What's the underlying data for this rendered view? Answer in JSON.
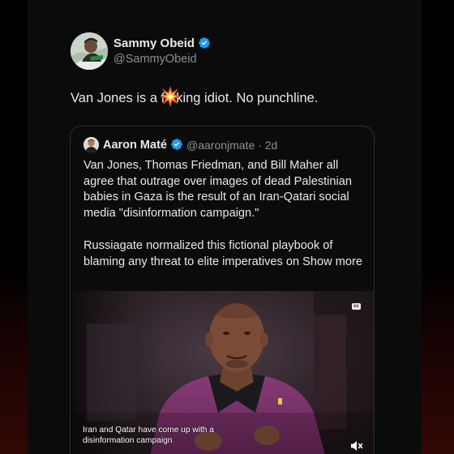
{
  "tweet": {
    "author": {
      "name": "Sammy Obeid",
      "handle": "@SammyObeid",
      "verified_icon": "verified-badge-icon"
    },
    "text_before": "Van Jones is a f",
    "text_emoji": "collision-emoji",
    "text_after": "king idiot. No punchline."
  },
  "quoted_tweet": {
    "author": {
      "name": "Aaron Maté",
      "handle": "@aaronjmate · 2d",
      "verified_icon": "verified-badge-icon"
    },
    "paragraphs": [
      "Van Jones, Thomas Friedman, and Bill Maher all agree that outrage over images of dead Palestinian babies in Gaza is the result of an Iran-Qatari social media \"disinformation campaign.\"",
      "Russiagate normalized this fictional playbook of blaming any threat to elite imperatives on"
    ],
    "show_more_label": "Show more",
    "video": {
      "cc_label": "cc",
      "caption_lines": [
        "Iran and Qatar have come up with a",
        "disinformation campaign"
      ],
      "mute_icon": "volume-muted-icon"
    }
  },
  "colors": {
    "background": "#000000",
    "panel": "#0b0b0c",
    "text_primary": "#e7e9ea",
    "text_secondary": "#8b8f94",
    "verified_blue": "#1d9bf0",
    "card_border": "#2b2f33"
  }
}
